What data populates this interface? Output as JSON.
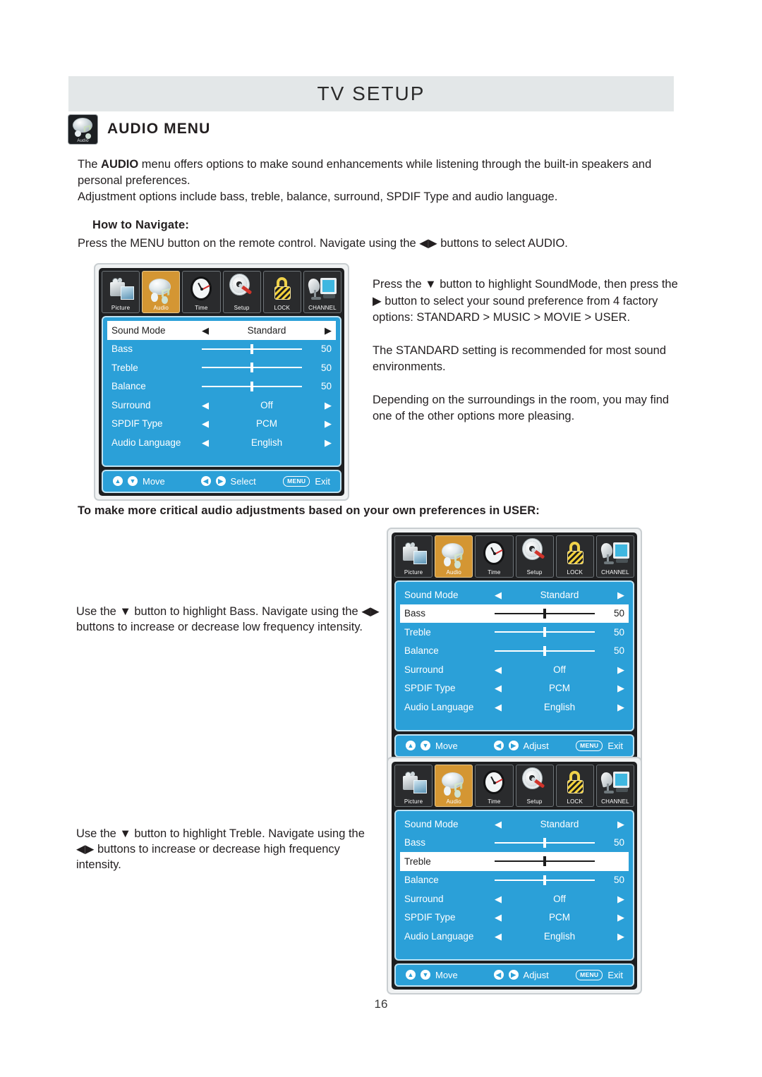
{
  "header": {
    "title": "TV SETUP",
    "section_title": "AUDIO MENU",
    "badge_label": "Audio"
  },
  "intro": {
    "line1_pre": "The ",
    "line1_bold": "AUDIO",
    "line1_post": " menu offers options to make sound enhancements while listening through the built-in speakers and personal preferences.",
    "line2": "Adjustment options include bass, treble, balance, surround, SPDIF Type and audio language."
  },
  "navigate": {
    "heading": "How to Navigate:",
    "text": "Press the MENU button on the remote control. Navigate using the ◀▶ buttons to select AUDIO."
  },
  "right_text": {
    "p1": "Press the ▼ button to highlight SoundMode, then press the ▶ button to select your sound preference from 4 factory options: STANDARD > MUSIC > MOVIE > USER.",
    "p2": "The STANDARD setting is recommended for most sound environments.",
    "p3": "Depending on the surroundings in the room, you may find one of the other options more pleasing."
  },
  "user_note": "To make more critical audio adjustments based on your own preferences in USER:",
  "bass_note": "Use the ▼ button to highlight Bass. Navigate using the ◀▶ buttons to increase or decrease low frequency intensity.",
  "treble_note": "Use the ▼ button to highlight Treble. Navigate using the ◀▶ buttons to increase or decrease high frequency intensity.",
  "page_number": "16",
  "colors": {
    "osd_blue": "#2ba0d8",
    "header_band": "#e3e7e8",
    "active_tab": "#d49633",
    "tab_dark": "#2a2b2d",
    "highlight_row_bg": "#ffffff"
  },
  "icon_tabs": [
    {
      "label": "Picture",
      "icon": "camcorder-icon",
      "active": false
    },
    {
      "label": "Audio",
      "icon": "speaker-note-icon",
      "active": true
    },
    {
      "label": "Time",
      "icon": "clock-icon",
      "active": false
    },
    {
      "label": "Setup",
      "icon": "gear-screwdriver-icon",
      "active": false
    },
    {
      "label": "LOCK",
      "icon": "padlock-icon",
      "active": false
    },
    {
      "label": "CHANNEL",
      "icon": "satellite-tv-icon",
      "active": false
    }
  ],
  "arrows": {
    "left": "◀",
    "right": "▶",
    "up": "▲",
    "down": "▼"
  },
  "menus": [
    {
      "id": "menu-sound-mode",
      "selected_row": 0,
      "rows": [
        {
          "label": "Sound Mode",
          "type": "option",
          "value": "Standard"
        },
        {
          "label": "Bass",
          "type": "slider",
          "value": "50",
          "position": 50
        },
        {
          "label": "Treble",
          "type": "slider",
          "value": "50",
          "position": 50
        },
        {
          "label": "Balance",
          "type": "slider",
          "value": "50",
          "position": 50
        },
        {
          "label": "Surround",
          "type": "option",
          "value": "Off"
        },
        {
          "label": "SPDIF Type",
          "type": "option",
          "value": "PCM"
        },
        {
          "label": "Audio Language",
          "type": "option",
          "value": "English"
        }
      ],
      "footer": {
        "move": "Move",
        "middle": "Select",
        "menu_key": "MENU",
        "exit": "Exit"
      }
    },
    {
      "id": "menu-bass",
      "selected_row": 1,
      "rows": [
        {
          "label": "Sound Mode",
          "type": "option",
          "value": "Standard"
        },
        {
          "label": "Bass",
          "type": "slider",
          "value": "50",
          "position": 50
        },
        {
          "label": "Treble",
          "type": "slider",
          "value": "50",
          "position": 50
        },
        {
          "label": "Balance",
          "type": "slider",
          "value": "50",
          "position": 50
        },
        {
          "label": "Surround",
          "type": "option",
          "value": "Off"
        },
        {
          "label": "SPDIF Type",
          "type": "option",
          "value": "PCM"
        },
        {
          "label": "Audio Language",
          "type": "option",
          "value": "English"
        }
      ],
      "footer": {
        "move": "Move",
        "middle": "Adjust",
        "menu_key": "MENU",
        "exit": "Exit"
      }
    },
    {
      "id": "menu-treble",
      "selected_row": 2,
      "rows": [
        {
          "label": "Sound Mode",
          "type": "option",
          "value": "Standard"
        },
        {
          "label": "Bass",
          "type": "slider",
          "value": "50",
          "position": 50
        },
        {
          "label": "Treble",
          "type": "slider",
          "value": "",
          "position": 50
        },
        {
          "label": "Balance",
          "type": "slider",
          "value": "50",
          "position": 50
        },
        {
          "label": "Surround",
          "type": "option",
          "value": "Off"
        },
        {
          "label": "SPDIF Type",
          "type": "option",
          "value": "PCM"
        },
        {
          "label": "Audio Language",
          "type": "option",
          "value": "English"
        }
      ],
      "footer": {
        "move": "Move",
        "middle": "Adjust",
        "menu_key": "MENU",
        "exit": "Exit"
      }
    }
  ]
}
